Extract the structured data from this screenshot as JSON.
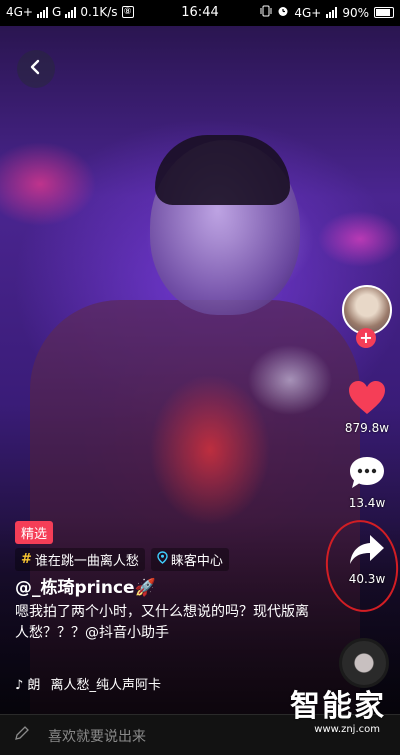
{
  "status_bar": {
    "network_left": "4G+",
    "network_mid": "G",
    "speed": "0.1K/s",
    "notif_icon": "⑧",
    "time": "16:44",
    "network_right": "4G+",
    "battery": "90%"
  },
  "badge": "精选",
  "tags": {
    "challenge": "谁在跳一曲离人愁",
    "location": "睐客中心"
  },
  "username": "@_栋琦prince🚀",
  "caption": "嗯我拍了两个小时，又什么想说的吗？现代版离人愁？？？@抖音小助手",
  "music": {
    "prefix": "♪ 朗",
    "title": "离人愁_纯人声阿卡"
  },
  "actions": {
    "likes": "879.8w",
    "comments": "13.4w",
    "shares": "40.3w"
  },
  "comment_bar": {
    "placeholder": "喜欢就要说出来"
  },
  "watermark": {
    "brand": "智能家",
    "url": "www.znj.com"
  },
  "icons": {
    "back": "chevron-left-icon",
    "like": "heart-icon",
    "comment": "comment-bubble-icon",
    "share": "share-arrow-icon",
    "follow": "plus-icon",
    "music": "tiktok-note-icon"
  },
  "colors": {
    "like": "#f53e57",
    "badge": "#f53e57",
    "challenge_hash": "#f7c531",
    "location": "#3fd0ff",
    "highlight_circle": "#d21e24"
  }
}
